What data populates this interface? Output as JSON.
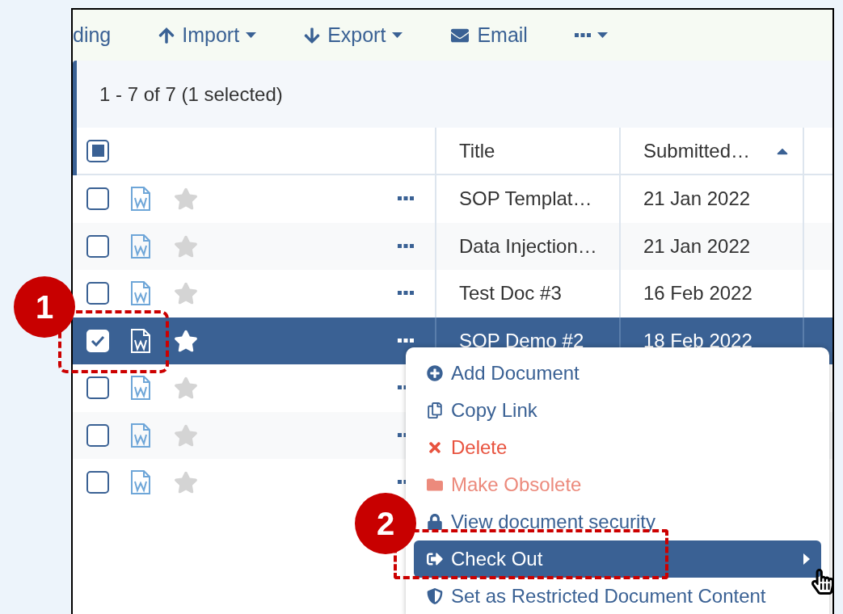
{
  "toolbar": {
    "items": [
      {
        "kind": "text",
        "label": "ding",
        "dropdown": false
      },
      {
        "kind": "import",
        "label": "Import",
        "dropdown": true
      },
      {
        "kind": "export",
        "label": "Export",
        "dropdown": true
      },
      {
        "kind": "email",
        "label": "Email",
        "dropdown": false
      },
      {
        "kind": "more",
        "dropdown": true
      }
    ]
  },
  "count": "1 - 7 of 7 (1 selected)",
  "table": {
    "select_all": {
      "indeterminate": true
    },
    "columns": [
      {
        "label": "Title",
        "sort_ascending": false
      },
      {
        "label": "Submitted…",
        "sort_ascending": true
      }
    ],
    "rows": [
      {
        "checked": false,
        "starred": false,
        "selected": false,
        "cells": [
          "SOP Templat…",
          "21 Jan 2022"
        ]
      },
      {
        "checked": false,
        "starred": false,
        "selected": false,
        "cells": [
          "Data Injection…",
          "21 Jan 2022"
        ]
      },
      {
        "checked": false,
        "starred": false,
        "selected": false,
        "cells": [
          "Test Doc #3",
          "16 Feb 2022"
        ]
      },
      {
        "checked": true,
        "starred": false,
        "selected": true,
        "cells": [
          "SOP Demo #2",
          "18 Feb 2022"
        ]
      },
      {
        "checked": false,
        "starred": false,
        "selected": false
      },
      {
        "checked": false,
        "starred": false,
        "selected": false
      },
      {
        "checked": false,
        "starred": false,
        "selected": false
      }
    ]
  },
  "context_menu": {
    "items": [
      {
        "kind": "add",
        "label": "Add Document",
        "color": "#3a6194",
        "selected": false,
        "submenu": false
      },
      {
        "kind": "copy",
        "label": "Copy Link",
        "color": "#3a6194",
        "selected": false,
        "submenu": false
      },
      {
        "kind": "delete",
        "label": "Delete",
        "color": "#e8533f",
        "selected": false,
        "submenu": false
      },
      {
        "kind": "obsolete",
        "label": "Make Obsolete",
        "color": "#ec8a7c",
        "selected": false,
        "submenu": false
      },
      {
        "kind": "security",
        "label": "View document security",
        "color": "#3a6194",
        "selected": false,
        "submenu": false
      },
      {
        "kind": "checkout",
        "label": "Check Out",
        "selected": true,
        "submenu": true
      },
      {
        "kind": "restricted",
        "label": "Set as Restricted Document Content",
        "color": "#3a6194",
        "selected": false,
        "submenu": false
      }
    ]
  },
  "callouts": [
    {
      "label": "1"
    },
    {
      "label": "2"
    }
  ]
}
